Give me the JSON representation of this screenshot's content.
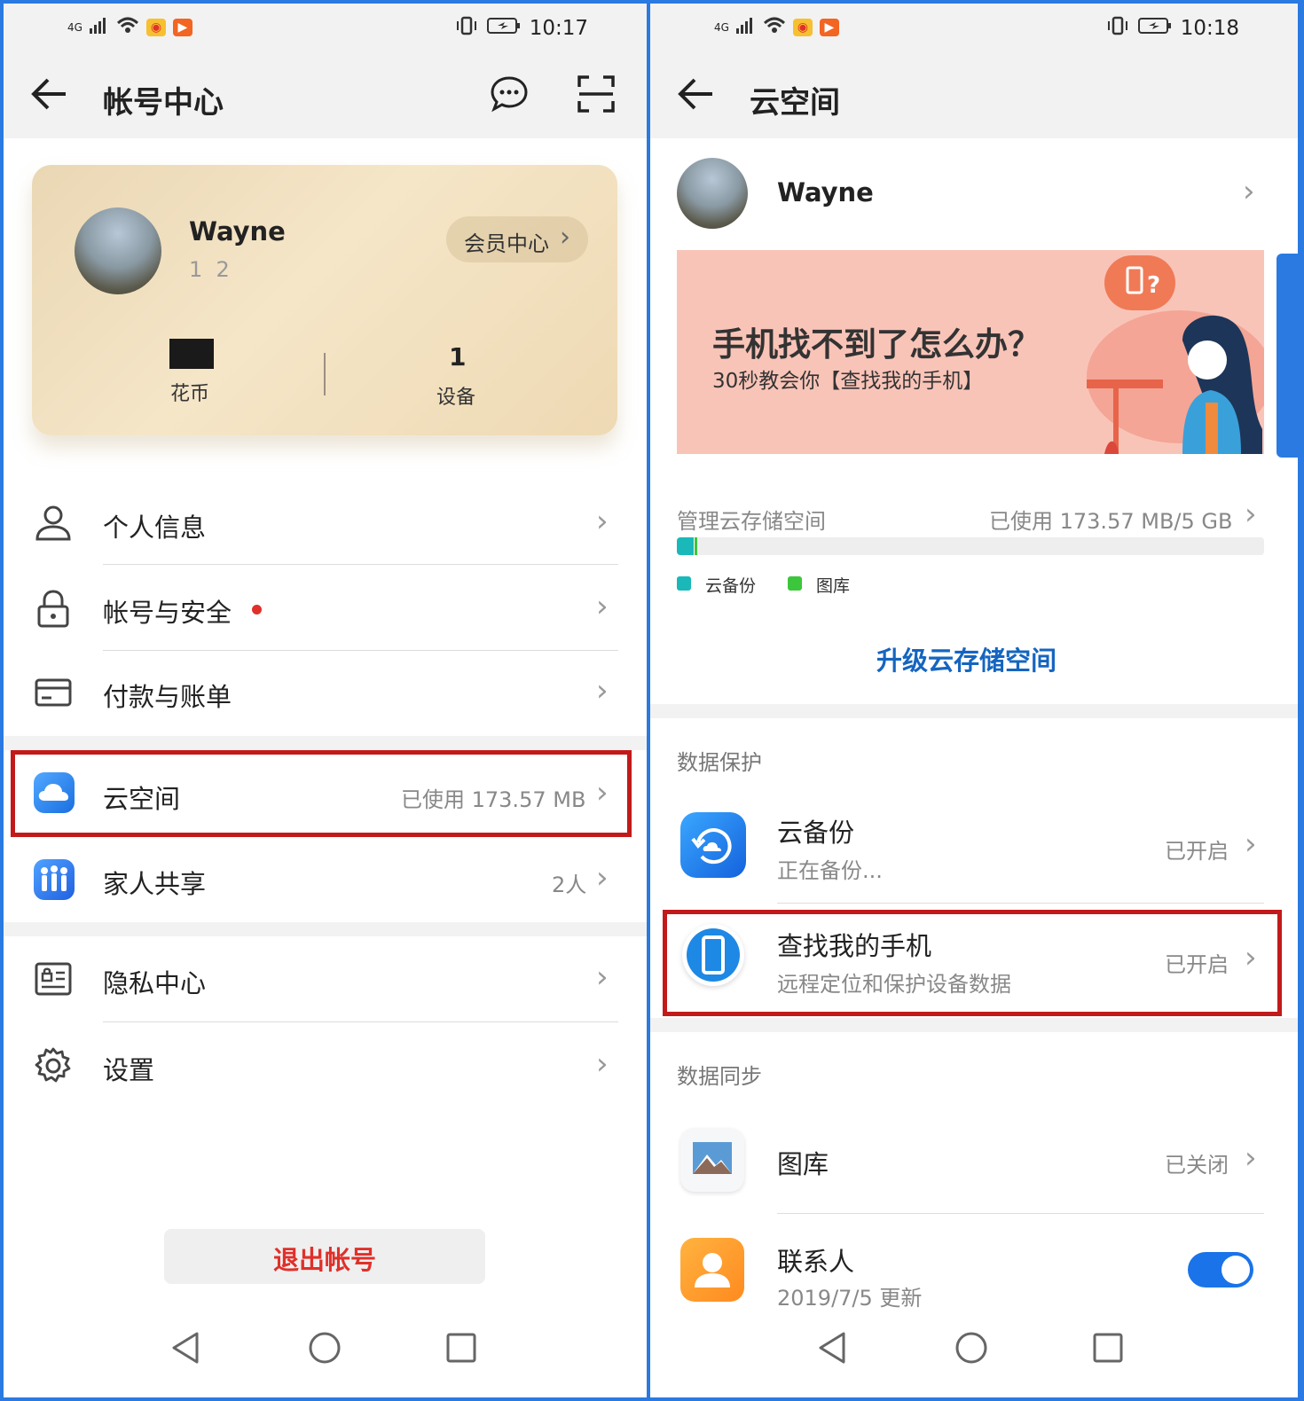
{
  "left": {
    "status": {
      "network": "4G",
      "time": "10:17"
    },
    "header": {
      "title": "帐号中心"
    },
    "profile": {
      "name": "Wayne",
      "phone_masked": "1  2",
      "member_center": "会员中心",
      "coins_label": "花币",
      "devices_count": "1",
      "devices_label": "设备"
    },
    "menu": {
      "personal_info": "个人信息",
      "account_security": "帐号与安全",
      "payments": "付款与账单",
      "cloud": "云空间",
      "cloud_usage": "已使用 173.57 MB",
      "family": "家人共享",
      "family_count": "2人",
      "privacy": "隐私中心",
      "settings": "设置"
    },
    "logout": "退出帐号"
  },
  "right": {
    "status": {
      "network": "4G",
      "time": "10:18"
    },
    "header": {
      "title": "云空间"
    },
    "user": {
      "name": "Wayne"
    },
    "banner": {
      "title": "手机找不到了怎么办？",
      "subtitle": "30秒教会你【查找我的手机】"
    },
    "storage": {
      "label": "管理云存储空间",
      "usage": "已使用 173.57 MB/5 GB",
      "used_fraction": 0.034,
      "legend": [
        {
          "name": "云备份",
          "color": "#1ab8b8"
        },
        {
          "name": "图库",
          "color": "#3cc63c"
        }
      ],
      "upgrade": "升级云存储空间"
    },
    "protection": {
      "header": "数据保护",
      "backup": {
        "title": "云备份",
        "subtitle": "正在备份...",
        "status": "已开启"
      },
      "findphone": {
        "title": "查找我的手机",
        "subtitle": "远程定位和保护设备数据",
        "status": "已开启"
      }
    },
    "sync": {
      "header": "数据同步",
      "gallery": {
        "title": "图库",
        "status": "已关闭"
      },
      "contacts": {
        "title": "联系人",
        "subtitle": "2019/7/5 更新",
        "enabled": true
      }
    }
  },
  "colors": {
    "accent": "#1565c0",
    "red_highlight": "#c21a1a",
    "logout": "#e0302a",
    "banner_bg": "#f9c4b8"
  }
}
